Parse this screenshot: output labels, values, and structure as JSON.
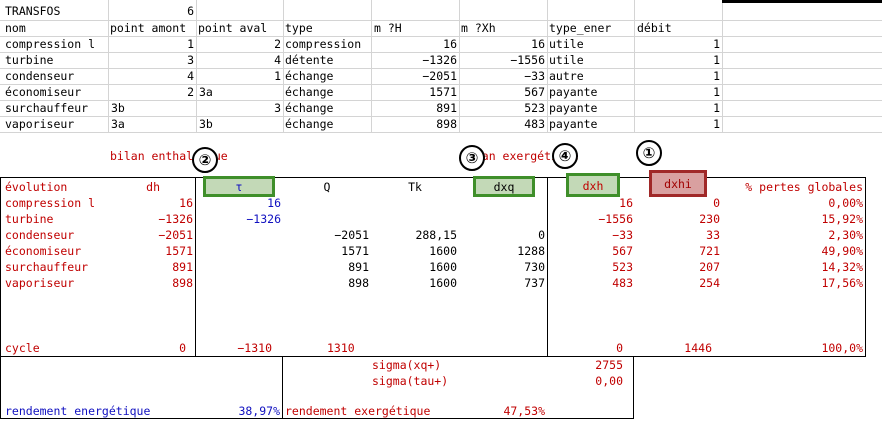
{
  "sheet": {
    "title_label": "TRANSFOS",
    "title_value": "6",
    "headers": [
      "nom",
      "point amont",
      "point aval",
      "type",
      "m ?H",
      "m ?Xh",
      "type_ener",
      "débit"
    ],
    "transforms": [
      {
        "nom": "compression l",
        "amont": "1",
        "aval": "2",
        "type": "compression",
        "mH": "16",
        "mXh": "16",
        "type_ener": "utile",
        "debit": "1"
      },
      {
        "nom": "turbine",
        "amont": "3",
        "aval": "4",
        "type": "détente",
        "mH": "−1326",
        "mXh": "−1556",
        "type_ener": "utile",
        "debit": "1"
      },
      {
        "nom": "condenseur",
        "amont": "4",
        "aval": "1",
        "type": "échange",
        "mH": "−2051",
        "mXh": "−33",
        "type_ener": "autre",
        "debit": "1"
      },
      {
        "nom": "économiseur",
        "amont": "2",
        "aval": "3a",
        "type": "échange",
        "mH": "1571",
        "mXh": "567",
        "type_ener": "payante",
        "debit": "1"
      },
      {
        "nom": "surchauffeur",
        "amont": "3b",
        "aval": "3",
        "type": "échange",
        "mH": "891",
        "mXh": "523",
        "type_ener": "payante",
        "debit": "1"
      },
      {
        "nom": "vaporiseur",
        "amont": "3a",
        "aval": "3b",
        "type": "échange",
        "mH": "898",
        "mXh": "483",
        "type_ener": "payante",
        "debit": "1"
      }
    ]
  },
  "bilan": {
    "enthalpique_label": "bilan enthalpique",
    "exergetique_label": "bilan exergétique",
    "badges": [
      "①",
      "②",
      "③",
      "④"
    ],
    "columns": {
      "evolution": "évolution",
      "dh": "dh",
      "tau": "τ",
      "q": "Q",
      "tk": "Tk",
      "dxq": "dxq",
      "dxh": "dxh",
      "dxhi": "dxhi",
      "pertes": "% pertes globales"
    },
    "rows": [
      {
        "evolution": "compression l",
        "dh": "16",
        "tau": "16",
        "q": "",
        "tk": "",
        "dxq": "",
        "dxh": "16",
        "dxhi": "0",
        "pertes": "0,00%"
      },
      {
        "evolution": "turbine",
        "dh": "−1326",
        "tau": "−1326",
        "q": "",
        "tk": "",
        "dxq": "",
        "dxh": "−1556",
        "dxhi": "230",
        "pertes": "15,92%"
      },
      {
        "evolution": "condenseur",
        "dh": "−2051",
        "tau": "",
        "q": "−2051",
        "tk": "288,15",
        "dxq": "0",
        "dxh": "−33",
        "dxhi": "33",
        "pertes": "2,30%"
      },
      {
        "evolution": "économiseur",
        "dh": "1571",
        "tau": "",
        "q": "1571",
        "tk": "1600",
        "dxq": "1288",
        "dxh": "567",
        "dxhi": "721",
        "pertes": "49,90%"
      },
      {
        "evolution": "surchauffeur",
        "dh": "891",
        "tau": "",
        "q": "891",
        "tk": "1600",
        "dxq": "730",
        "dxh": "523",
        "dxhi": "207",
        "pertes": "14,32%"
      },
      {
        "evolution": "vaporiseur",
        "dh": "898",
        "tau": "",
        "q": "898",
        "tk": "1600",
        "dxq": "737",
        "dxh": "483",
        "dxhi": "254",
        "pertes": "17,56%"
      }
    ],
    "cycle": {
      "label": "cycle",
      "dh": "0",
      "tau": "−1310",
      "q": "1310",
      "dxh": "0",
      "dxhi": "1446",
      "pertes": "100,0%"
    },
    "sigma_xq_label": "sigma(xq+)",
    "sigma_xq_value": "2755",
    "sigma_tau_label": "sigma(tau+)",
    "sigma_tau_value": "0,00",
    "rendement_energetique_label": "rendement energétique",
    "rendement_energetique_value": "38,97%",
    "rendement_exergetique_label": "rendement exergétique",
    "rendement_exergetique_value": "47,53%"
  },
  "colors": {
    "red_text": "#c00000",
    "blue_text": "#1010c0",
    "green_fill": "#c3d9b7",
    "green_border": "#3f8f2a",
    "red_fill": "#d9a0a0",
    "red_border": "#a02828"
  }
}
